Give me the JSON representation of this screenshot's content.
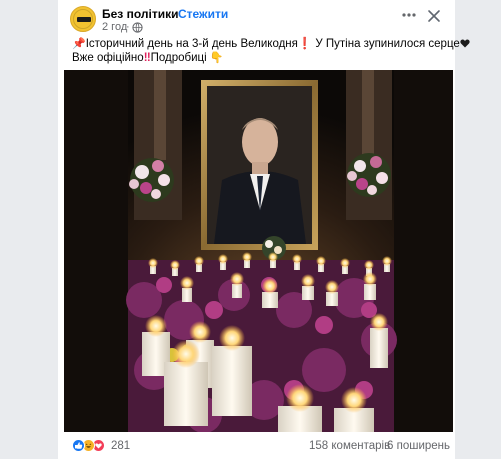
{
  "header": {
    "page_name": "Без політики",
    "separator": "·",
    "follow_label": "Стежити",
    "post_time": "2 год",
    "time_separator": "·",
    "audience_icon": "globe-icon",
    "more_icon": "more-horizontal-icon",
    "close_icon": "close-icon"
  },
  "caption": {
    "line1_pre": "Історичний день на 3-й день Великодня",
    "line1_mid": " У Путіна зупинилося серце",
    "line2_pre": "Вже офіційно",
    "line2_mid": "Подробиці",
    "pin_emoji": "📌",
    "excl_emoji": "❗",
    "hand_emoji": "👇"
  },
  "photo": {
    "description_icon": "memorial-photo"
  },
  "footer": {
    "reaction_count": "281",
    "comments": "158 коментарів",
    "shares": "6 поширень",
    "reactions": [
      "like",
      "haha",
      "love"
    ]
  },
  "colors": {
    "link": "#1877f2",
    "secondary_text": "#65676b",
    "like": "#1877f2",
    "haha": "#f7b125",
    "love": "#f33e58"
  }
}
